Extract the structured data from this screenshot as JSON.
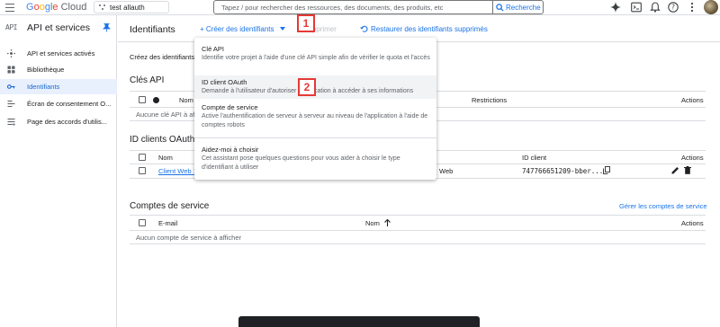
{
  "topbar": {
    "logo": {
      "g": "G",
      "o1": "o",
      "o2": "o",
      "g2": "g",
      "l": "l",
      "e": "e",
      "cloud": " Cloud"
    },
    "project": "test allauth",
    "search_placeholder": "Tapez / pour rechercher des ressources, des documents, des produits, etc",
    "search_button": "Recherche"
  },
  "sidebar": {
    "badge": "API",
    "title": "API et services",
    "items": [
      {
        "label": "API et services activés",
        "icon": "hub-icon"
      },
      {
        "label": "Bibliothèque",
        "icon": "library-icon"
      },
      {
        "label": "Identifiants",
        "icon": "key-icon",
        "active": true
      },
      {
        "label": "Écran de consentement O...",
        "icon": "consent-icon"
      },
      {
        "label": "Page des accords d'utilis...",
        "icon": "settings-list-icon"
      }
    ]
  },
  "header": {
    "title": "Identifiants",
    "create": "+ Créer des identifiants",
    "delete": "Supprimer",
    "restore": "Restaurer des identifiants supprimés"
  },
  "intro": "Créez des identifiants",
  "api_keys": {
    "title": "Clés API",
    "col_name": "Nom",
    "col_restrictions": "Restrictions",
    "col_actions": "Actions",
    "empty": "Aucune clé API à afficher"
  },
  "oauth": {
    "title": "ID clients OAuth 2.0",
    "col_name": "Nom",
    "col_client_id": "ID client",
    "col_actions": "Actions",
    "row": {
      "name": "Client Web 1",
      "type": "Web",
      "client_id": "747766651209-bber..."
    }
  },
  "service": {
    "title": "Comptes de service",
    "manage_link": "Gérer les comptes de service",
    "col_email": "E-mail",
    "col_name": "Nom",
    "col_actions": "Actions",
    "empty": "Aucun compte de service à afficher"
  },
  "dropdown": {
    "items": [
      {
        "title": "Clé API",
        "desc": "Identifie votre projet à l'aide d'une clé API simple afin de vérifier le quota et l'accès"
      },
      {
        "title": "ID client OAuth",
        "desc": "Demande à l'utilisateur d'autoriser l'application à accéder à ses informations"
      },
      {
        "title": "Compte de service",
        "desc": "Active l'authentification de serveur à serveur au niveau de l'application à l'aide de comptes robots"
      },
      {
        "title": "Aidez-moi à choisir",
        "desc": "Cet assistant pose quelques questions pour vous aider à choisir le type d'identifiant à utiliser"
      }
    ]
  },
  "markers": [
    "1",
    "2"
  ],
  "colors": {
    "accent": "#1a73e8",
    "active_bg": "#e8f0fe",
    "marker": "#e53935"
  }
}
